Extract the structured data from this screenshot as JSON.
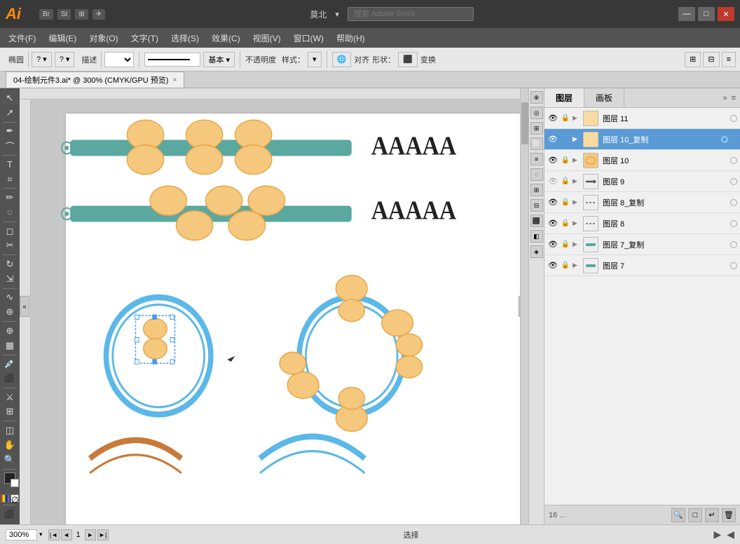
{
  "app": {
    "logo": "Ai",
    "bridge_label": "Br",
    "stock_label": "St",
    "location": "莫北",
    "search_placeholder": "搜索 Adobe Stock",
    "title": "Adobe Illustrator"
  },
  "title_bar": {
    "minimize": "—",
    "maximize": "□",
    "close": "✕"
  },
  "menu": {
    "items": [
      "文件(F)",
      "编辑(E)",
      "对象(O)",
      "文字(T)",
      "选择(S)",
      "效果(C)",
      "视图(V)",
      "窗口(W)",
      "帮助(H)"
    ]
  },
  "toolbar": {
    "shape_label": "椭圆",
    "desc_label": "描述",
    "mode_dropdown": "基本 ▾",
    "opacity_label": "不透明度",
    "style_label": "样式：",
    "align_label": "对齐",
    "shape_label2": "形状：",
    "transform_label": "变换"
  },
  "tab": {
    "title": "04-绘制元件3.ai* @ 300% (CMYK/GPU 预览)",
    "close": "×"
  },
  "canvas": {
    "zoom": "300%",
    "page": "1",
    "tool_status": "选择"
  },
  "layers_panel": {
    "tab1": "图层",
    "tab2": "画板",
    "layers": [
      {
        "id": 11,
        "name": "图层 11",
        "visible": true,
        "locked": false,
        "has_arrow": true,
        "thumb_type": "plain",
        "thumb_color": "#f5c87e",
        "active": true,
        "selected": false,
        "indicator": "circle"
      },
      {
        "id": "10_copy",
        "name": "图层 10_复制",
        "visible": true,
        "locked": false,
        "has_arrow": true,
        "thumb_type": "dotted",
        "thumb_color": "#f5c87e",
        "active": true,
        "selected": true,
        "indicator": "square"
      },
      {
        "id": 10,
        "name": "图层 10",
        "visible": true,
        "locked": false,
        "has_arrow": true,
        "thumb_type": "plain",
        "thumb_color": "#f5c87e",
        "active": false,
        "selected": false,
        "indicator": "circle"
      },
      {
        "id": 9,
        "name": "图层 9",
        "visible": false,
        "locked": false,
        "has_arrow": true,
        "thumb_type": "arrow",
        "thumb_color": "#555",
        "active": false,
        "selected": false,
        "indicator": "circle"
      },
      {
        "id": "8_copy",
        "name": "图层 8_复制",
        "visible": true,
        "locked": false,
        "has_arrow": true,
        "thumb_type": "dashed",
        "thumb_color": "#aaa",
        "active": false,
        "selected": false,
        "indicator": "circle"
      },
      {
        "id": 8,
        "name": "图层 8",
        "visible": true,
        "locked": false,
        "has_arrow": true,
        "thumb_type": "dashed",
        "thumb_color": "#aaa",
        "active": false,
        "selected": false,
        "indicator": "circle"
      },
      {
        "id": "7_copy",
        "name": "图层 7_复制",
        "visible": true,
        "locked": false,
        "has_arrow": true,
        "thumb_type": "teal_bar",
        "thumb_color": "#5ba8a0",
        "active": false,
        "selected": false,
        "indicator": "circle"
      },
      {
        "id": 7,
        "name": "图层 7",
        "visible": true,
        "locked": false,
        "has_arrow": true,
        "thumb_type": "teal_bar",
        "thumb_color": "#5ba8a0",
        "active": false,
        "selected": false,
        "indicator": "circle"
      }
    ],
    "footer_count": "16 ...",
    "footer_buttons": [
      "🔍",
      "□",
      "↵",
      "🗑"
    ]
  },
  "right_panel_tools": [
    "◉",
    "◈",
    "⧉",
    "⬜",
    "◌",
    "◉",
    "⊞",
    "⊟",
    "⬛",
    "◧",
    "⊕"
  ]
}
